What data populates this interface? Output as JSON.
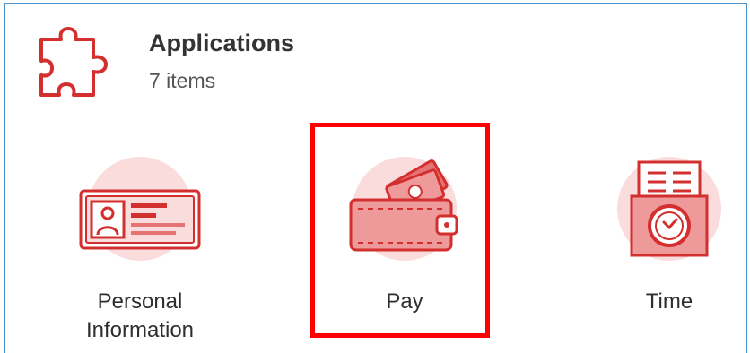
{
  "header": {
    "title": "Applications",
    "count": "7 items",
    "icon": "puzzle-icon"
  },
  "apps": [
    {
      "label": "Personal\nInformation",
      "icon": "id-card-icon"
    },
    {
      "label": "Pay",
      "icon": "wallet-icon"
    },
    {
      "label": "Time",
      "icon": "time-clock-icon"
    }
  ],
  "colors": {
    "accent": "#d32f2f",
    "icon_fill": "#fbdcdc",
    "highlight": "#ff0000",
    "frame": "#4a90c8"
  }
}
